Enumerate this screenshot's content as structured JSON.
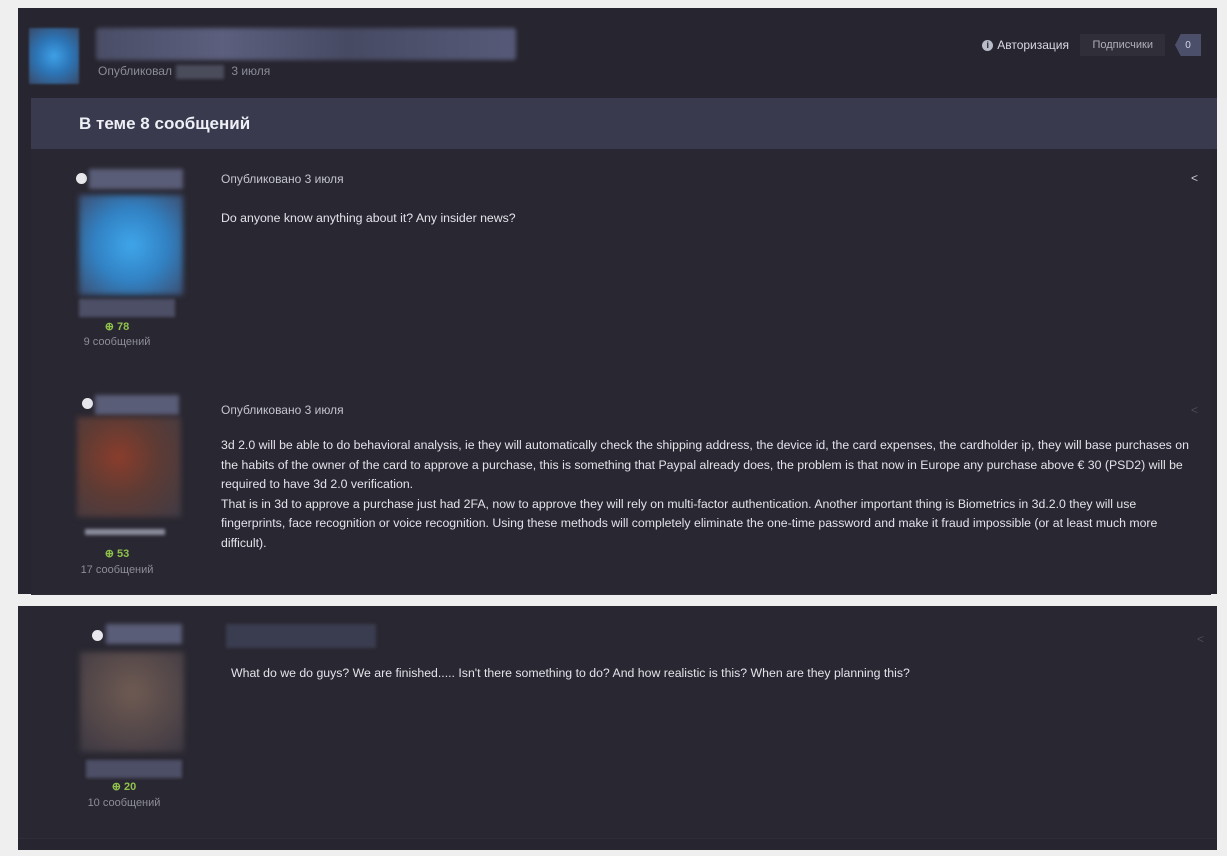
{
  "header": {
    "published_by_label": "Опубликовал",
    "published_date": "3 июля",
    "login_label": "Авторизация",
    "followers_label": "Подписчики",
    "followers_count": "0"
  },
  "topic": {
    "count_label": "В теме 8 сообщений"
  },
  "posts": [
    {
      "date": "Опубликовано 3 июля",
      "body": "Do anyone know anything about it? Any insider news?",
      "reputation": "78",
      "post_count": "9 сообщений"
    },
    {
      "date": "Опубликовано 3 июля",
      "body": "3d 2.0 will be able to do behavioral analysis, ie they will automatically check the shipping address, the device id, the card expenses, the cardholder ip, they will base purchases on the habits of the owner of the card to approve a purchase, this is something that Paypal already does, the problem is that now in Europe any purchase above € 30 (PSD2) will be required to have 3d 2.0 verification.",
      "body2": "That is in 3d to approve a purchase just had 2FA, now to approve they will rely on multi-factor authentication. Another important thing is Biometrics in 3d.2.0 they will use fingerprints, face recognition or voice recognition. Using these methods will completely eliminate the one-time password and make it fraud impossible (or at least much more difficult).",
      "reputation": "53",
      "post_count": "17 сообщений"
    },
    {
      "body": "What do we do guys? We are finished..... Isn't there something to do? And how realistic is this? When are they planning this?",
      "reputation": "20",
      "post_count": "10 сообщений"
    }
  ],
  "colors": {
    "background": "#27252f",
    "count_bar": "#3a3a4f",
    "reputation_green": "#8fc24b"
  },
  "icons": {
    "info": "info-icon",
    "share": "share-icon",
    "reputation": "plus-circle-icon"
  }
}
